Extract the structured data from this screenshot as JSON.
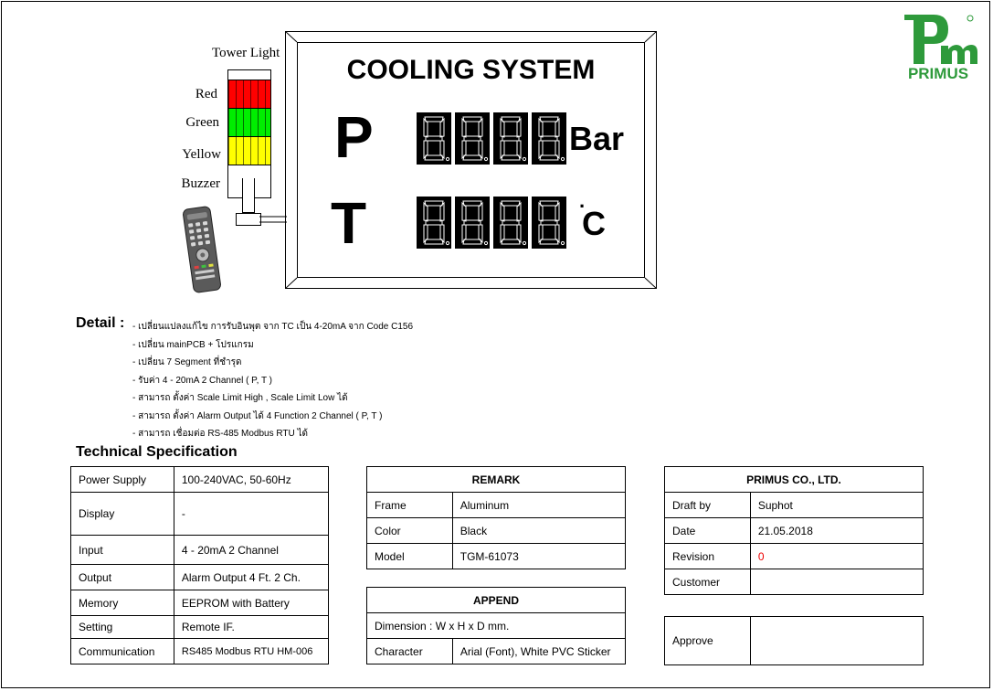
{
  "logo": {
    "mark": "Pm",
    "text": "PRIMUS"
  },
  "tower_light": {
    "title": "Tower Light",
    "labels": [
      "Red",
      "Green",
      "Yellow",
      "Buzzer"
    ],
    "colors": {
      "red": "#ff0000",
      "green": "#00ee00",
      "yellow": "#ffff00"
    }
  },
  "panel": {
    "title": "COOLING SYSTEM",
    "row_p": {
      "letter": "P",
      "unit": "Bar"
    },
    "row_t": {
      "letter": "T",
      "unit": "C",
      "degree": "·"
    }
  },
  "detail": {
    "heading": "Detail :",
    "items": [
      "- เปลี่ยนแปลงแก้ไข การรับอินพุต จาก TC เป็น 4-20mA จาก Code C156",
      "- เปลี่ยน mainPCB + โปรแกรม",
      "- เปลี่ยน 7 Segment ที่ชำรุด",
      "- รับค่า 4 - 20mA 2 Channel  ( P, T )",
      "- สามารถ ตั้งค่า Scale Limit High , Scale Limit Low ได้",
      "- สามารถ ตั้งค่า Alarm Output ได้ 4 Function 2 Channel ( P, T )",
      "- สามารถ เชื่อมต่อ RS-485 Modbus RTU ได้"
    ]
  },
  "tech_spec": {
    "heading": "Technical Specification",
    "rows": [
      {
        "label": "Power Supply",
        "value": "100-240VAC, 50-60Hz"
      },
      {
        "label": "Display",
        "value": "-"
      },
      {
        "label": "Input",
        "value": "4 - 20mA  2 Channel"
      },
      {
        "label": "Output",
        "value": "Alarm Output 4 Ft.  2 Ch."
      },
      {
        "label": "Memory",
        "value": "EEPROM with Battery"
      },
      {
        "label": "Setting",
        "value": "Remote IF."
      },
      {
        "label": "Communication",
        "value": "RS485 Modbus RTU  HM-006"
      }
    ]
  },
  "remark": {
    "heading": "REMARK",
    "rows": [
      {
        "label": "Frame",
        "value": "Aluminum"
      },
      {
        "label": "Color",
        "value": "Black"
      },
      {
        "label": "Model",
        "value": "TGM-61073"
      }
    ]
  },
  "append": {
    "heading": "APPEND",
    "dimension": "Dimension : W x H x D mm.",
    "character_label": "Character",
    "character_value": "Arial (Font), White PVC Sticker"
  },
  "company": {
    "heading": "PRIMUS CO., LTD.",
    "rows": [
      {
        "label": "Draft by",
        "value": "Suphot"
      },
      {
        "label": "Date",
        "value": "21.05.2018"
      },
      {
        "label": "Revision",
        "value": "0"
      },
      {
        "label": "Customer",
        "value": ""
      }
    ],
    "approve_label": "Approve",
    "revision_color": "#e00000"
  }
}
